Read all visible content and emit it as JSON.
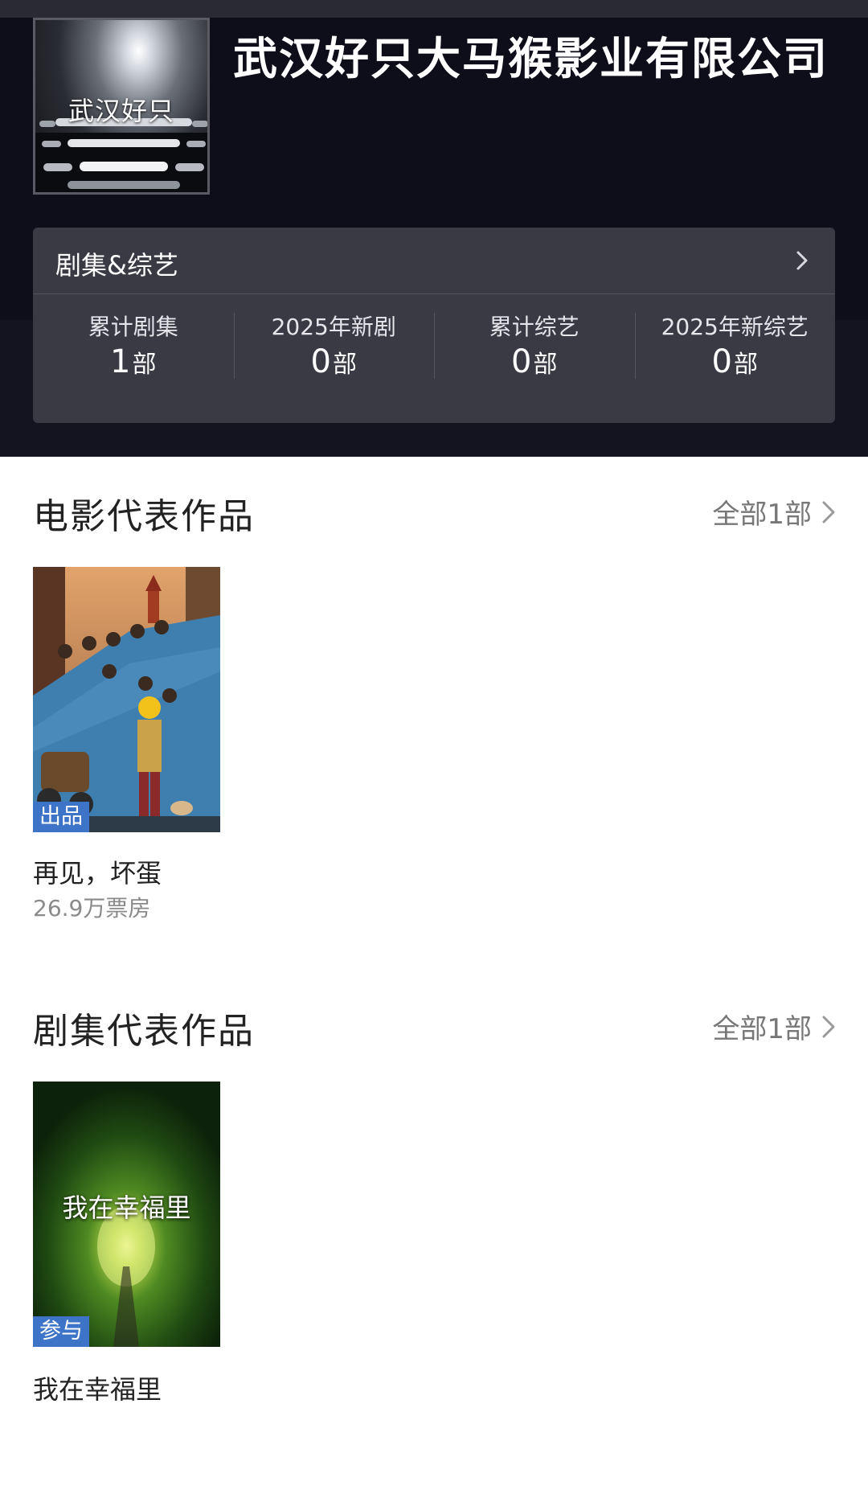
{
  "company": {
    "logo_text": "武汉好只",
    "name": "武汉好只大马猴影业有限公司"
  },
  "stats_card": {
    "title": "剧集&综艺",
    "items": [
      {
        "label": "累计剧集",
        "value": "1",
        "unit": "部"
      },
      {
        "label": "2025年新剧",
        "value": "0",
        "unit": "部"
      },
      {
        "label": "累计综艺",
        "value": "0",
        "unit": "部"
      },
      {
        "label": "2025年新综艺",
        "value": "0",
        "unit": "部"
      }
    ]
  },
  "movies": {
    "title": "电影代表作品",
    "more": "全部1部",
    "items": [
      {
        "badge": "出品",
        "title": "再见，坏蛋",
        "box_office": "26.9万票房",
        "poster_icon": "movie-poster"
      }
    ]
  },
  "series": {
    "title": "剧集代表作品",
    "more": "全部1部",
    "items": [
      {
        "badge": "参与",
        "title": "我在幸福里",
        "poster_text": "我在幸福里",
        "poster_icon": "series-poster"
      }
    ]
  },
  "colors": {
    "header_bg": "#0e0d1a",
    "card_bg": "#3a3a45",
    "badge_bg": "#3d74c7"
  }
}
